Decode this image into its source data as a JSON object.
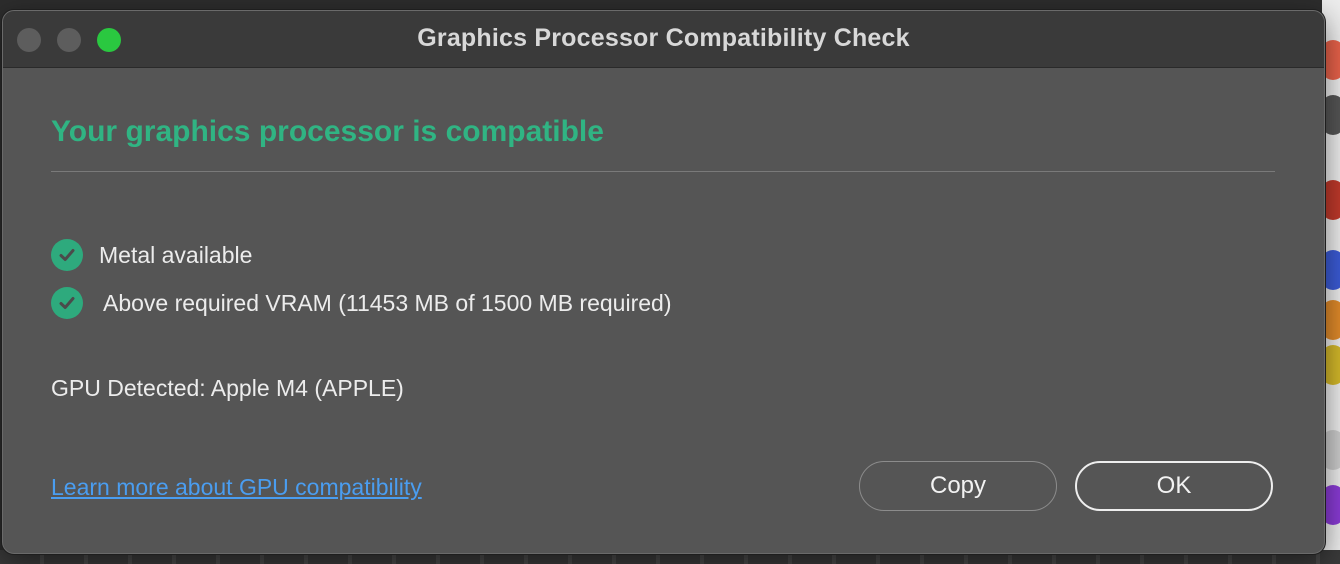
{
  "window": {
    "title": "Graphics Processor Compatibility Check"
  },
  "result": {
    "heading": "Your graphics processor is compatible",
    "heading_color": "#30b483"
  },
  "checks": [
    {
      "label": "Metal available",
      "icon": "checkmark-circle-icon",
      "passed": true
    },
    {
      "label": "Above required VRAM (11453 MB of 1500 MB required)",
      "icon": "checkmark-circle-icon",
      "passed": true
    }
  ],
  "gpu": {
    "detected_text": "GPU Detected: Apple M4 (APPLE)"
  },
  "footer": {
    "link_label": "Learn more about GPU compatibility",
    "copy_label": "Copy",
    "ok_label": "OK"
  },
  "colors": {
    "accent_green": "#30b483",
    "link_blue": "#4a9df0",
    "window_bg": "#555555"
  }
}
